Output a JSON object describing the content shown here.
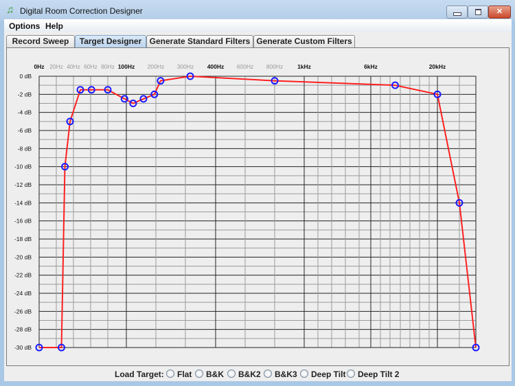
{
  "window": {
    "title": "Digital Room Correction Designer",
    "icon": "music-note-icon",
    "close_glyph": "✕"
  },
  "menu": [
    "Options",
    "Help"
  ],
  "tabs": [
    {
      "label": "Record Sweep",
      "active": false
    },
    {
      "label": "Target Designer",
      "active": true
    },
    {
      "label": "Generate Standard Filters",
      "active": false
    },
    {
      "label": "Generate Custom Filters",
      "active": false
    }
  ],
  "load_target": {
    "label": "Load Target:",
    "options": [
      "Flat",
      "B&K",
      "B&K2",
      "B&K3",
      "Deep Tilt",
      "Deep Tilt 2"
    ],
    "selected": null
  },
  "colors": {
    "curve": "#ff2020",
    "point": "#1a1aff"
  },
  "chart_data": {
    "type": "line",
    "x_tick_labels": [
      {
        "label": "0Hz",
        "hz": 0,
        "major": true
      },
      {
        "label": "20Hz",
        "hz": 20,
        "major": false
      },
      {
        "label": "40Hz",
        "hz": 40,
        "major": false
      },
      {
        "label": "60Hz",
        "hz": 60,
        "major": false
      },
      {
        "label": "80Hz",
        "hz": 80,
        "major": false
      },
      {
        "label": "100Hz",
        "hz": 100,
        "major": true
      },
      {
        "label": "200Hz",
        "hz": 200,
        "major": false
      },
      {
        "label": "300Hz",
        "hz": 300,
        "major": false
      },
      {
        "label": "400Hz",
        "hz": 400,
        "major": true
      },
      {
        "label": "600Hz",
        "hz": 600,
        "major": false
      },
      {
        "label": "800Hz",
        "hz": 800,
        "major": false
      },
      {
        "label": "1kHz",
        "hz": 1000,
        "major": true
      },
      {
        "label": "6kHz",
        "hz": 6000,
        "major": true
      },
      {
        "label": "20kHz",
        "hz": 20000,
        "major": true
      }
    ],
    "y_tick_labels": [
      "0 dB",
      "-2 dB",
      "-4 dB",
      "-6 dB",
      "-8 dB",
      "-10 dB",
      "-12 dB",
      "-14 dB",
      "-16 dB",
      "-18 dB",
      "-20 dB",
      "-22 dB",
      "-24 dB",
      "-26 dB",
      "-28 dB",
      "-30 dB"
    ],
    "ylim": [
      -30,
      0
    ],
    "grid": true,
    "points": [
      {
        "hz": 0,
        "db": -30
      },
      {
        "hz": 26,
        "db": -30
      },
      {
        "hz": 30,
        "db": -10
      },
      {
        "hz": 36,
        "db": -5
      },
      {
        "hz": 48,
        "db": -1.5
      },
      {
        "hz": 61,
        "db": -1.5
      },
      {
        "hz": 80,
        "db": -1.5
      },
      {
        "hz": 98,
        "db": -2.5
      },
      {
        "hz": 123,
        "db": -3
      },
      {
        "hz": 158,
        "db": -2.5
      },
      {
        "hz": 195,
        "db": -2
      },
      {
        "hz": 216,
        "db": -0.5
      },
      {
        "hz": 316,
        "db": 0
      },
      {
        "hz": 800,
        "db": -0.5
      },
      {
        "hz": 11000,
        "db": -1
      },
      {
        "hz": 20000,
        "db": -2
      },
      {
        "hz": 22000,
        "db": -14
      },
      {
        "hz": 24000,
        "db": -30
      }
    ]
  }
}
